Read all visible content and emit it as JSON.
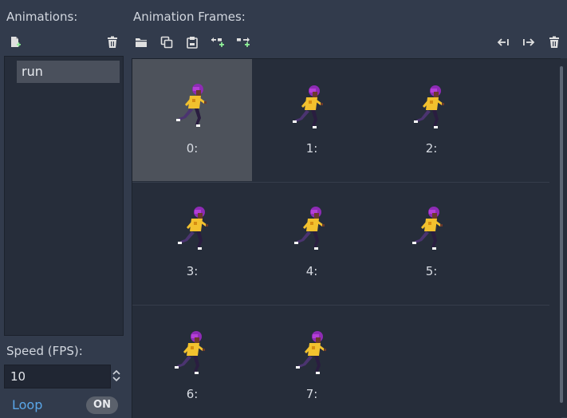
{
  "left_panel": {
    "title": "Animations:",
    "animations": [
      {
        "name": "run"
      }
    ],
    "speed_label": "Speed (FPS):",
    "speed_value": "10",
    "loop_label": "Loop",
    "loop_state": "ON"
  },
  "frames_panel": {
    "title": "Animation Frames:",
    "frames": [
      {
        "label": "0:"
      },
      {
        "label": "1:"
      },
      {
        "label": "2:"
      },
      {
        "label": "3:"
      },
      {
        "label": "4:"
      },
      {
        "label": "5:"
      },
      {
        "label": "6:"
      },
      {
        "label": "7:"
      }
    ],
    "selected_index": 0
  },
  "icons": {
    "new_animation": "new-animation-icon",
    "delete_animation": "trash-icon",
    "load_frames": "folder-icon",
    "copy": "copy-icon",
    "paste": "paste-icon",
    "insert_before": "insert-before-icon",
    "insert_after": "insert-after-icon",
    "move_left": "arrow-left-icon",
    "move_right": "arrow-right-icon",
    "delete_frame": "trash-icon"
  },
  "colors": {
    "background": "#323b4c",
    "panel": "#262d3a",
    "selection": "#4d525b",
    "accent": "#5aa6e8",
    "add_icon": "#8eef97"
  }
}
